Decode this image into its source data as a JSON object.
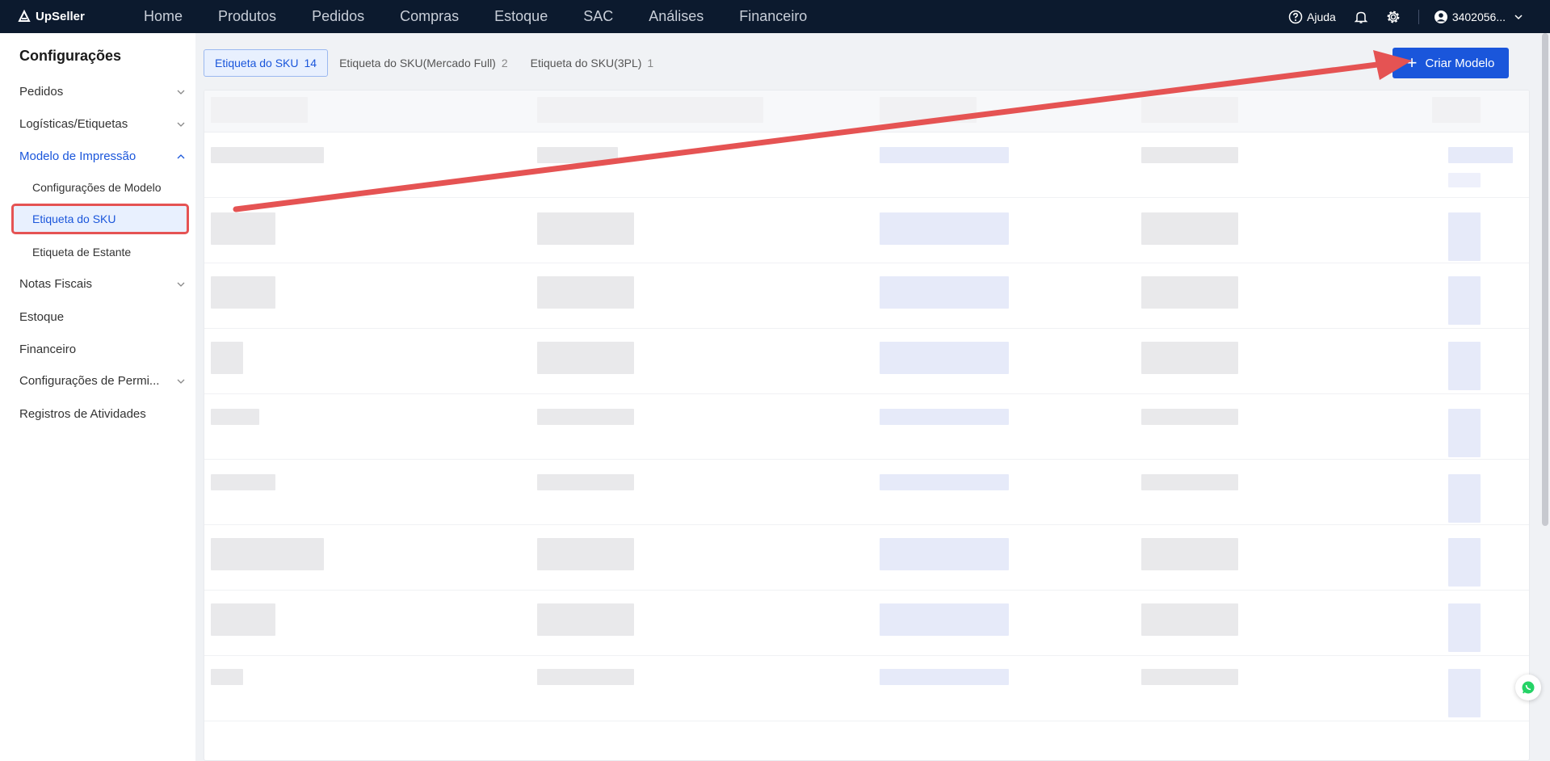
{
  "brand": {
    "name": "UpSeller"
  },
  "nav": {
    "items": [
      {
        "label": "Home"
      },
      {
        "label": "Produtos"
      },
      {
        "label": "Pedidos"
      },
      {
        "label": "Compras"
      },
      {
        "label": "Estoque"
      },
      {
        "label": "SAC"
      },
      {
        "label": "Análises"
      },
      {
        "label": "Financeiro"
      }
    ],
    "help_label": "Ajuda",
    "user_label": "3402056..."
  },
  "sidebar": {
    "title": "Configurações",
    "items": [
      {
        "label": "Pedidos"
      },
      {
        "label": "Logísticas/Etiquetas"
      },
      {
        "label": "Modelo de Impressão"
      },
      {
        "label": "Notas Fiscais"
      },
      {
        "label": "Estoque"
      },
      {
        "label": "Financeiro"
      },
      {
        "label": "Configurações de Permi..."
      },
      {
        "label": "Registros de Atividades"
      }
    ],
    "sub_items": [
      {
        "label": "Configurações de Modelo"
      },
      {
        "label": "Etiqueta do SKU"
      },
      {
        "label": "Etiqueta de Estante"
      }
    ]
  },
  "tabs": [
    {
      "label": "Etiqueta do SKU",
      "count": "14"
    },
    {
      "label": "Etiqueta do SKU(Mercado Full)",
      "count": "2"
    },
    {
      "label": "Etiqueta do SKU(3PL)",
      "count": "1"
    }
  ],
  "create_button": {
    "label": "Criar Modelo"
  },
  "colors": {
    "nav_bg": "#0c1a2e",
    "accent": "#1a56db",
    "annotation": "#e55353"
  }
}
